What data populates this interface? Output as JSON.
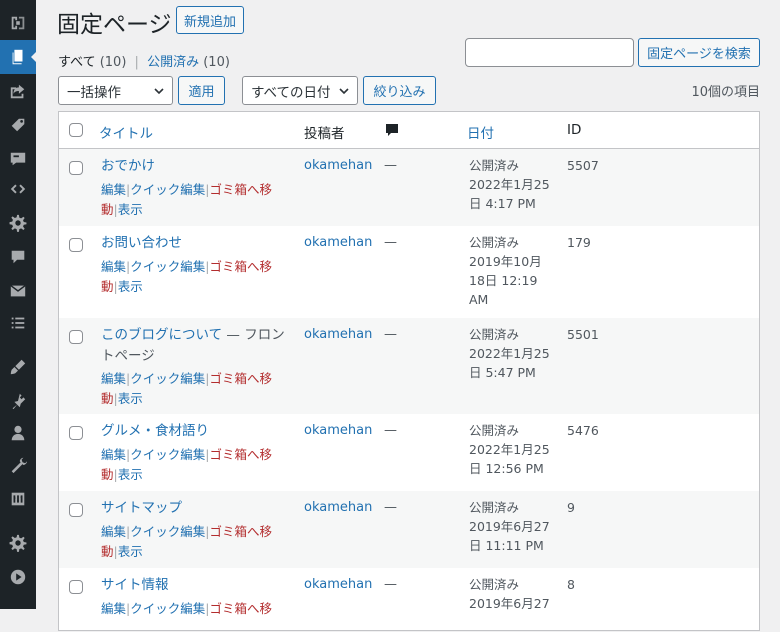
{
  "sidebar": {
    "items": [
      {
        "icon": "dashboard-icon"
      },
      {
        "icon": "pages-icon",
        "active": true
      },
      {
        "icon": "share-icon"
      },
      {
        "icon": "tag-icon"
      },
      {
        "icon": "feedback-icon"
      },
      {
        "icon": "code-icon"
      },
      {
        "icon": "gear-icon"
      },
      {
        "icon": "comments-icon"
      },
      {
        "icon": "mail-icon"
      },
      {
        "icon": "list-icon"
      },
      {
        "icon": "appearance-icon"
      },
      {
        "icon": "plugins-icon"
      },
      {
        "icon": "users-icon"
      },
      {
        "icon": "tools-icon"
      },
      {
        "icon": "settings-icon"
      },
      {
        "icon": "settings2-icon"
      },
      {
        "icon": "play-icon"
      }
    ]
  },
  "page": {
    "title": "固定ページ",
    "add_new": "新規追加",
    "filters": {
      "all_label": "すべて",
      "all_count": "(10)",
      "separator": "|",
      "published_label": "公開済み",
      "published_count": "(10)"
    },
    "search": {
      "placeholder": "",
      "button": "固定ページを検索"
    },
    "bulk": {
      "select": "一括操作",
      "apply": "適用"
    },
    "dates": {
      "select": "すべての日付",
      "filter": "絞り込み"
    },
    "items_count": "10個の項目"
  },
  "table": {
    "headers": {
      "title": "タイトル",
      "author": "投稿者",
      "date": "日付",
      "id": "ID"
    },
    "action_labels": {
      "edit": "編集",
      "quick_edit": "クイック編集",
      "trash_1": "ゴミ箱へ移",
      "trash_2": "動",
      "view": "表示",
      "sep": "|"
    },
    "rows": [
      {
        "title": "おでかけ",
        "author": "okamehan",
        "comments": "—",
        "status": "公開済み",
        "date_1": "2022年1月25",
        "date_2": "日 4:17 PM",
        "id": "5507"
      },
      {
        "title": "お問い合わせ",
        "author": "okamehan",
        "comments": "—",
        "status": "公開済み",
        "date_1": "2019年10月",
        "date_2": "18日 12:19",
        "date_3": "AM",
        "id": "179"
      },
      {
        "title": "このブログについて",
        "title_dash": "—",
        "title_suffix_1": "フロン",
        "title_suffix_2": "トページ",
        "author": "okamehan",
        "comments": "—",
        "status": "公開済み",
        "date_1": "2022年1月25",
        "date_2": "日 5:47 PM",
        "id": "5501"
      },
      {
        "title": "グルメ・食材語り",
        "author": "okamehan",
        "comments": "—",
        "status": "公開済み",
        "date_1": "2022年1月25",
        "date_2": "日 12:56 PM",
        "id": "5476"
      },
      {
        "title": "サイトマップ",
        "author": "okamehan",
        "comments": "—",
        "status": "公開済み",
        "date_1": "2019年6月27",
        "date_2": "日 11:11 PM",
        "id": "9"
      },
      {
        "title": "サイト情報",
        "author": "okamehan",
        "comments": "—",
        "status": "公開済み",
        "date_1": "2019年6月27",
        "id": "8"
      }
    ]
  }
}
